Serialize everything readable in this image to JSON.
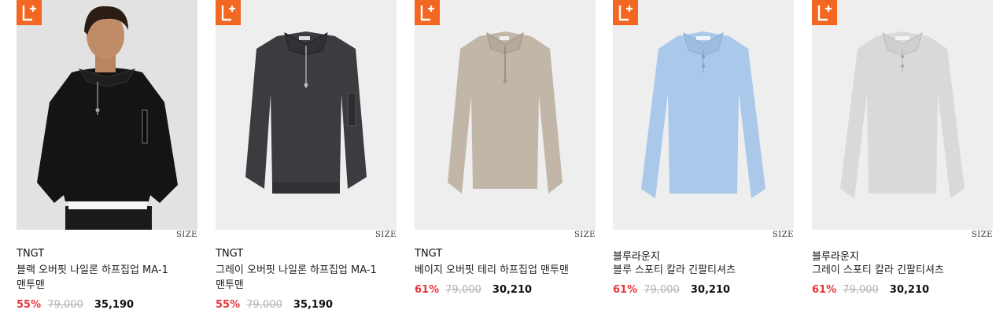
{
  "badge_color": "#f26722",
  "discount_color": "#e8363d",
  "products": [
    {
      "badge_icon": "l-plus-icon",
      "size_label": "SIZE",
      "brand": "TNGT",
      "name": "블랙 오버핏 나일론 하프집업 MA-1 맨투맨",
      "discount": "55%",
      "original_price": "79,000",
      "price": "35,190",
      "image": "model wearing black half-zip sweatshirt",
      "color": "#1c1c1e"
    },
    {
      "badge_icon": "l-plus-icon",
      "size_label": "SIZE",
      "brand": "TNGT",
      "name": "그레이 오버핏 나일론 하프집업 MA-1 맨투맨",
      "discount": "55%",
      "original_price": "79,000",
      "price": "35,190",
      "image": "charcoal half-zip nylon sweatshirt",
      "color": "#3a3c40"
    },
    {
      "badge_icon": "l-plus-icon",
      "size_label": "SIZE",
      "brand": "TNGT",
      "name": "베이지 오버핏 테리 하프집업 맨투맨",
      "discount": "61%",
      "original_price": "79,000",
      "price": "30,210",
      "image": "beige half-zip terry sweatshirt",
      "color": "#c2b6a9"
    },
    {
      "badge_icon": "l-plus-icon",
      "size_label": "SIZE",
      "brand": "블루라운지",
      "name": "블루 스포티 칼라 긴팔티셔츠",
      "discount": "61%",
      "original_price": "79,000",
      "price": "30,210",
      "image": "light blue long-sleeve polo shirt",
      "color": "#a9c8ea"
    },
    {
      "badge_icon": "l-plus-icon",
      "size_label": "SIZE",
      "brand": "블루라운지",
      "name": "그레이 스포티 칼라 긴팔티셔츠",
      "discount": "61%",
      "original_price": "79,000",
      "price": "30,210",
      "image": "light gray long-sleeve polo shirt",
      "color": "#d9d9d9"
    }
  ]
}
